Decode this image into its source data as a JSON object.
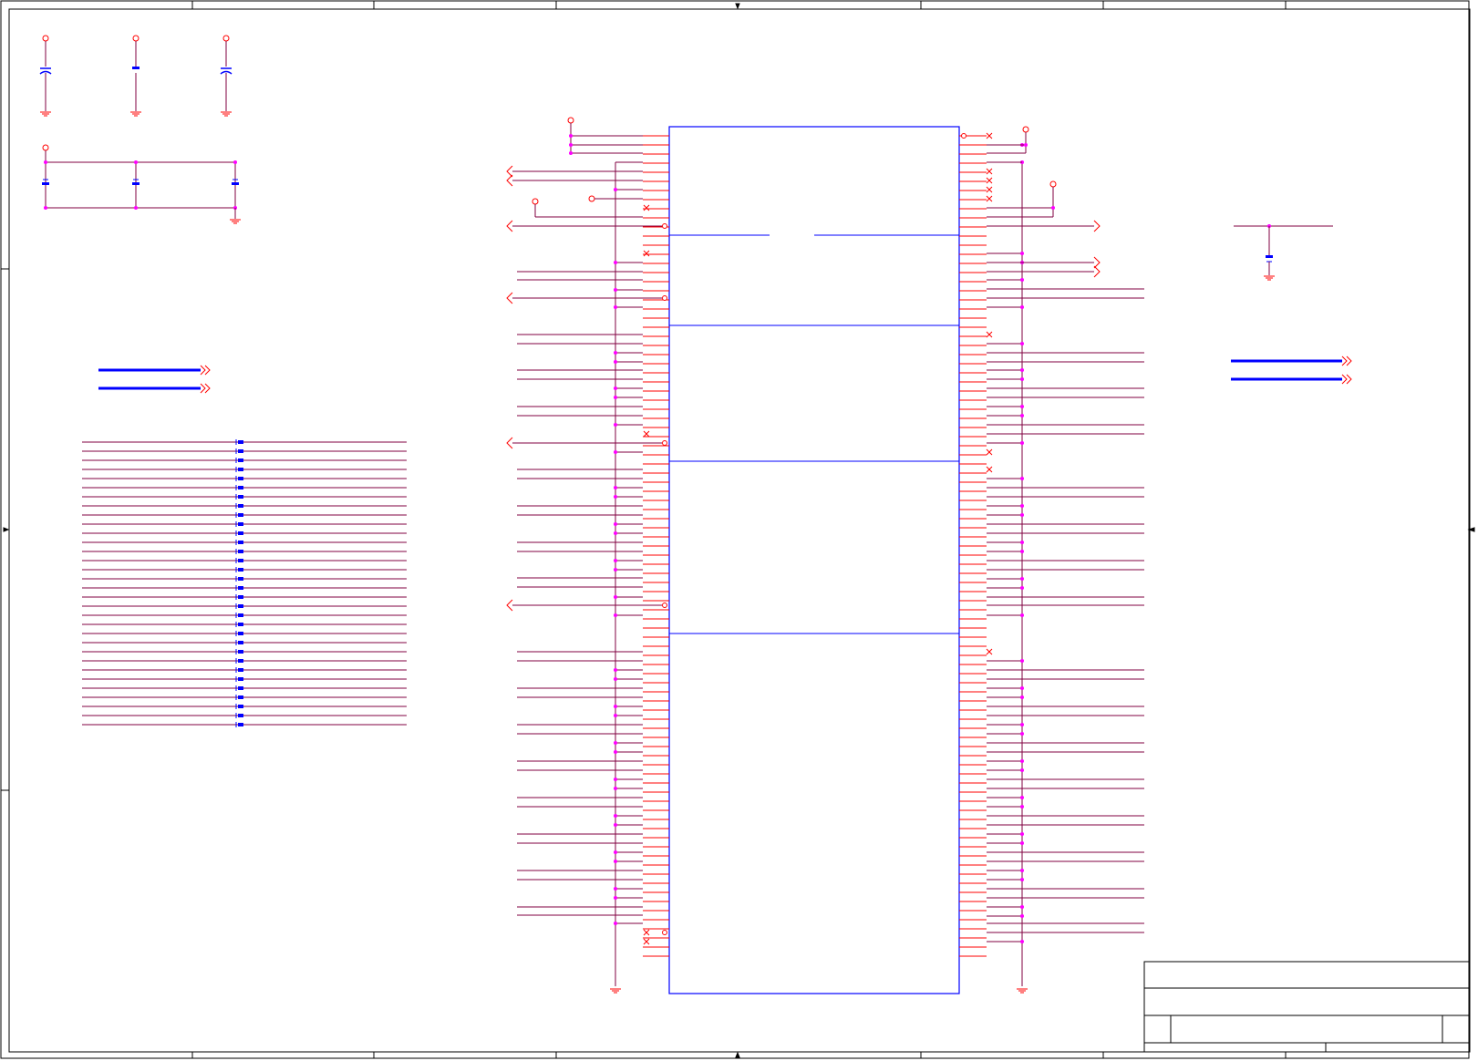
{
  "sheet": {
    "background": "#ffffff",
    "frame_color": "#000000",
    "part_color": "#0000ff",
    "wire_color": "#800040",
    "pin_color": "#ff0000",
    "junction_color": "#ff00ff"
  },
  "title_block": {
    "title": "",
    "document_number": "",
    "revision": "",
    "size": "",
    "date": "",
    "sheet": ""
  },
  "symbols": {
    "power_port": "circle-power-port-icon",
    "ground": "ground-icon",
    "capacitor": "capacitor-icon",
    "no_connect": "no-connect-icon",
    "offpage_connector": "offpage-connector-icon",
    "bus_entry": "bus-connector-icon"
  }
}
